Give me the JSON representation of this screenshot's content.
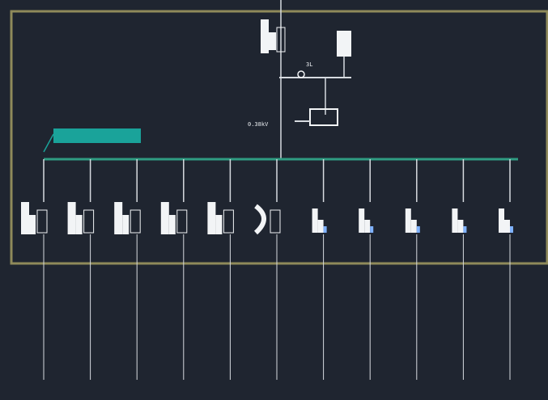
{
  "drawing": {
    "colors": {
      "background": "#1f2530",
      "panel_border": "#8f8a5a",
      "bus": "#2f9c82",
      "feeder_wire": "#d7dbe0",
      "breaker": "#f2f4f6",
      "breaker_accent": "#7fb2ff",
      "label_tag": "#1aa39a",
      "circuit_text": "#cfe9e6"
    },
    "main": {
      "label_left": "0.38kV",
      "label_right": "3L"
    },
    "bus_label": "",
    "feeders": [
      {
        "type": "breaker",
        "label": ""
      },
      {
        "type": "breaker",
        "label": ""
      },
      {
        "type": "breaker",
        "label": ""
      },
      {
        "type": "breaker",
        "label": ""
      },
      {
        "type": "breaker",
        "label": ""
      },
      {
        "type": "contactor",
        "label": ""
      },
      {
        "type": "switch",
        "label": ""
      },
      {
        "type": "switch",
        "label": ""
      },
      {
        "type": "switch",
        "label": ""
      },
      {
        "type": "switch",
        "label": ""
      },
      {
        "type": "switch",
        "label": ""
      }
    ]
  }
}
